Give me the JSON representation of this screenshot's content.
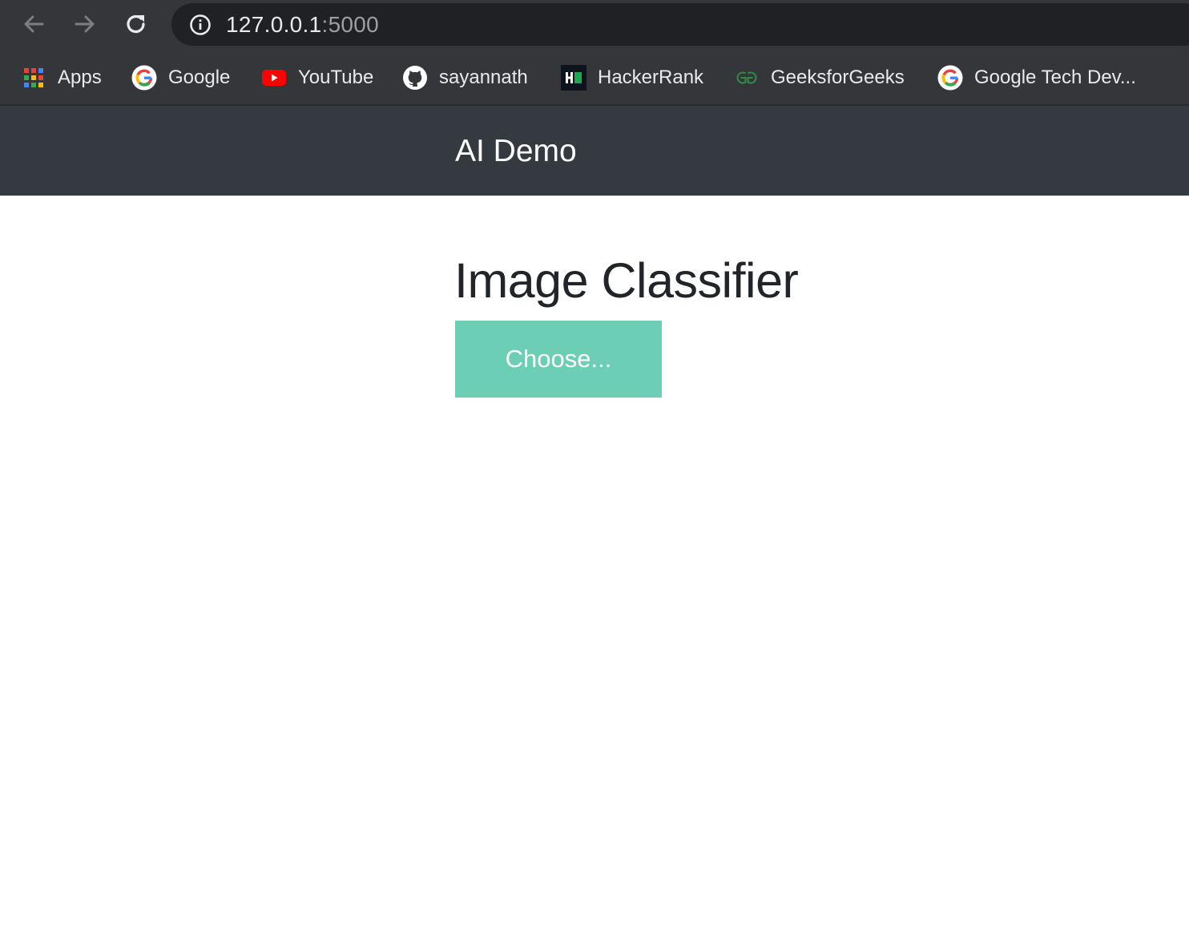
{
  "browser": {
    "url_host": "127.0.0.1",
    "url_port": ":5000",
    "icons": {
      "back": "arrow-left-icon",
      "forward": "arrow-right-icon",
      "reload": "reload-icon",
      "site_info": "info-icon"
    }
  },
  "bookmarks": [
    {
      "label": "Apps",
      "icon": "apps-grid-icon"
    },
    {
      "label": "Google",
      "icon": "google-icon"
    },
    {
      "label": "YouTube",
      "icon": "youtube-icon"
    },
    {
      "label": "sayannath",
      "icon": "github-icon"
    },
    {
      "label": "HackerRank",
      "icon": "hackerrank-icon"
    },
    {
      "label": "GeeksforGeeks",
      "icon": "geeksforgeeks-icon"
    },
    {
      "label": "Google Tech Dev...",
      "icon": "google-icon"
    }
  ],
  "navbar": {
    "brand": "AI Demo",
    "background": "#343a40"
  },
  "main": {
    "title": "Image Classifier",
    "choose_button": "Choose...",
    "button_color": "#6ccfb5"
  }
}
